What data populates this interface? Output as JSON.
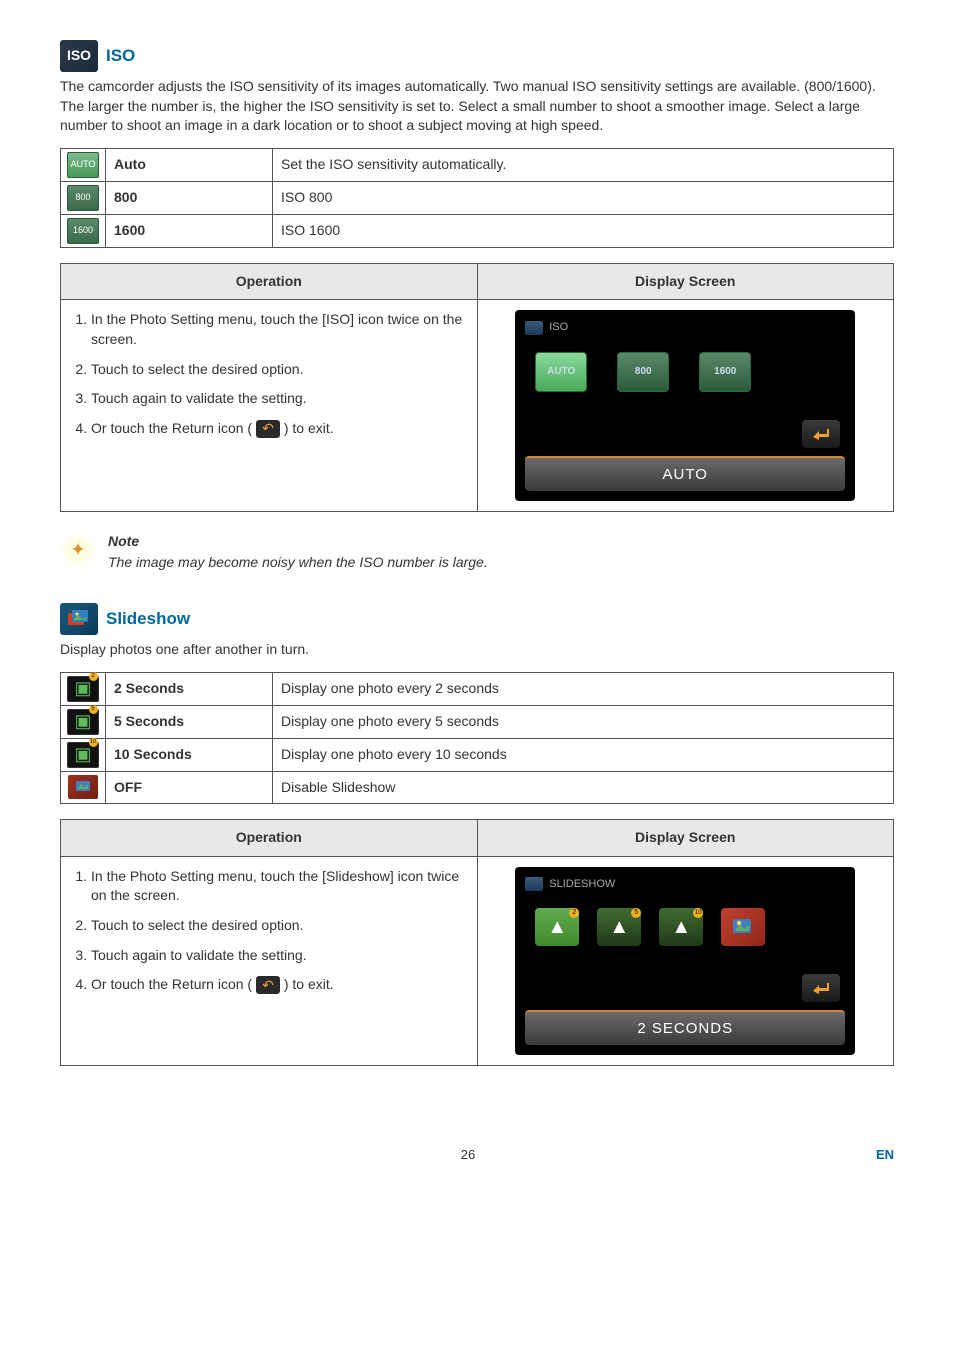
{
  "iso": {
    "title": "ISO",
    "description": "The camcorder adjusts the ISO sensitivity of its images automatically. Two manual ISO sensitivity settings are available. (800/1600). The larger the number is, the higher the ISO sensitivity is set to. Select a small number to shoot a smoother image. Select a large number to shoot an image in a dark location or to shoot a subject moving at high speed.",
    "options": [
      {
        "icon": "AUTO",
        "label": "Auto",
        "desc": "Set the ISO sensitivity automatically."
      },
      {
        "icon": "800",
        "label": "800",
        "desc": "ISO 800"
      },
      {
        "icon": "1600",
        "label": "1600",
        "desc": "ISO 1600"
      }
    ],
    "operation": {
      "header_op": "Operation",
      "header_ds": "Display Screen",
      "steps": [
        "In the Photo Setting menu, touch the [ISO] icon twice on the screen.",
        "Touch to select the desired option.",
        "Touch again to validate the setting.",
        "Or touch the Return icon ( __RETURN_ICON__ ) to exit."
      ],
      "screen": {
        "title": "ISO",
        "buttons": [
          "AUTO",
          "800",
          "1600"
        ],
        "footer": "AUTO"
      }
    },
    "note": {
      "title": "Note",
      "text": "The image may become noisy when the ISO number is large."
    }
  },
  "slideshow": {
    "title": "Slideshow",
    "description": "Display photos one after another in turn.",
    "options": [
      {
        "label": "2 Seconds",
        "desc": "Display one photo every 2 seconds"
      },
      {
        "label": "5 Seconds",
        "desc": "Display one photo every 5 seconds"
      },
      {
        "label": "10 Seconds",
        "desc": "Display one photo every 10 seconds"
      },
      {
        "label": "OFF",
        "desc": "Disable Slideshow"
      }
    ],
    "operation": {
      "header_op": "Operation",
      "header_ds": "Display Screen",
      "steps": [
        "In the Photo Setting menu, touch the [Slideshow] icon twice on the screen.",
        "Touch to select the desired option.",
        "Touch again to validate the setting.",
        "Or touch the Return icon ( __RETURN_ICON__ ) to exit."
      ],
      "screen": {
        "title": "SLIDESHOW",
        "footer": "2 SECONDS"
      }
    }
  },
  "footer": {
    "page": "26",
    "lang": "EN"
  }
}
